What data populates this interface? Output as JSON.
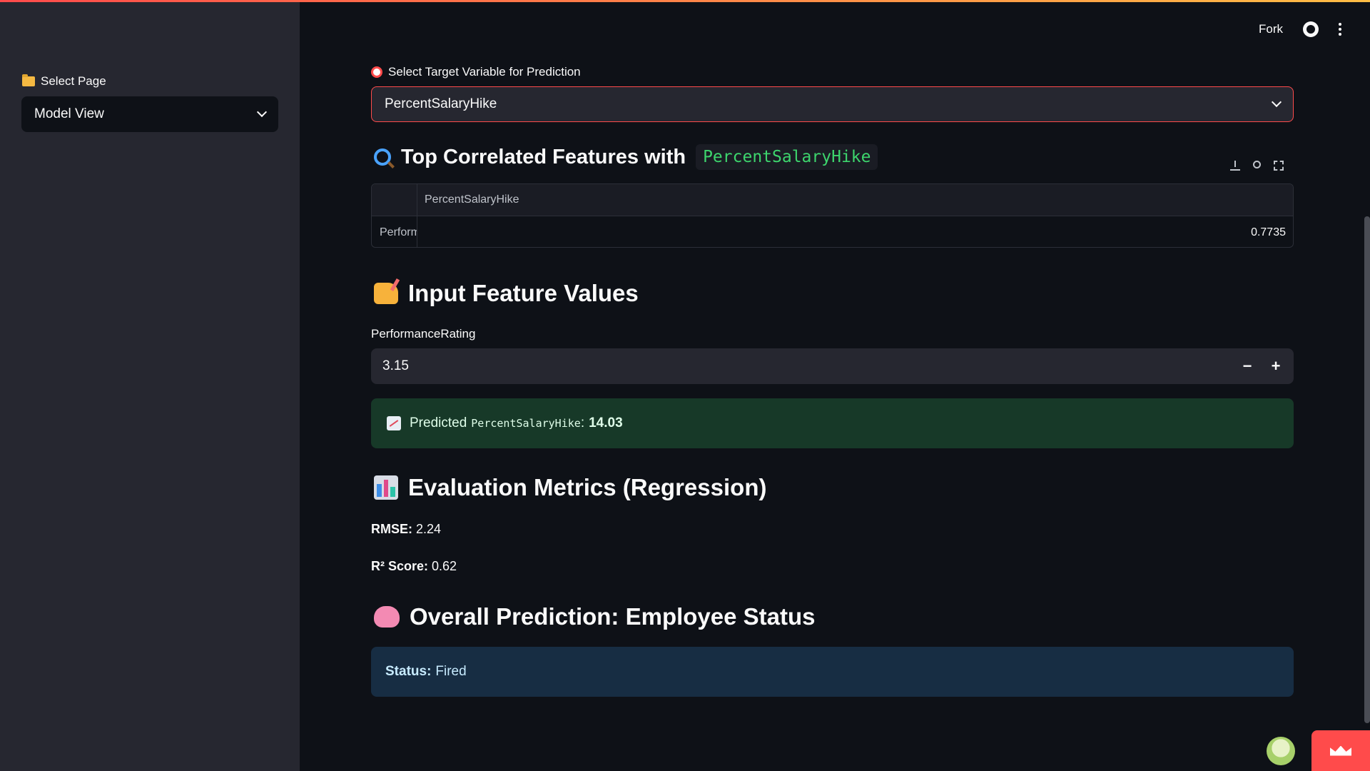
{
  "header": {
    "fork_label": "Fork"
  },
  "sidebar": {
    "label": "Select Page",
    "select_value": "Model View"
  },
  "target": {
    "label": "Select Target Variable for Prediction",
    "value": "PercentSalaryHike"
  },
  "correlation": {
    "heading": "Top Correlated Features with",
    "target_code": "PercentSalaryHike",
    "table": {
      "columns": [
        "PercentSalaryHike"
      ],
      "rows": [
        {
          "index": "PerformanceRating",
          "values": [
            "0.7735"
          ]
        }
      ]
    }
  },
  "input_features": {
    "heading": "Input Feature Values",
    "field_label": "PerformanceRating",
    "field_value": "3.15"
  },
  "prediction": {
    "prefix": "Predicted",
    "target_code": "PercentSalaryHike",
    "separator": ":",
    "value": "14.03"
  },
  "metrics": {
    "heading": "Evaluation Metrics (Regression)",
    "rmse_label": "RMSE:",
    "rmse_value": "2.24",
    "r2_label": "R² Score:",
    "r2_value": "0.62"
  },
  "overall": {
    "heading": "Overall Prediction: Employee Status",
    "status_label": "Status:",
    "status_value": "Fired"
  },
  "colors": {
    "accent": "#ff4b4b",
    "success_bg": "#173928",
    "info_bg": "#172d43",
    "code_green": "#3dd56d"
  }
}
